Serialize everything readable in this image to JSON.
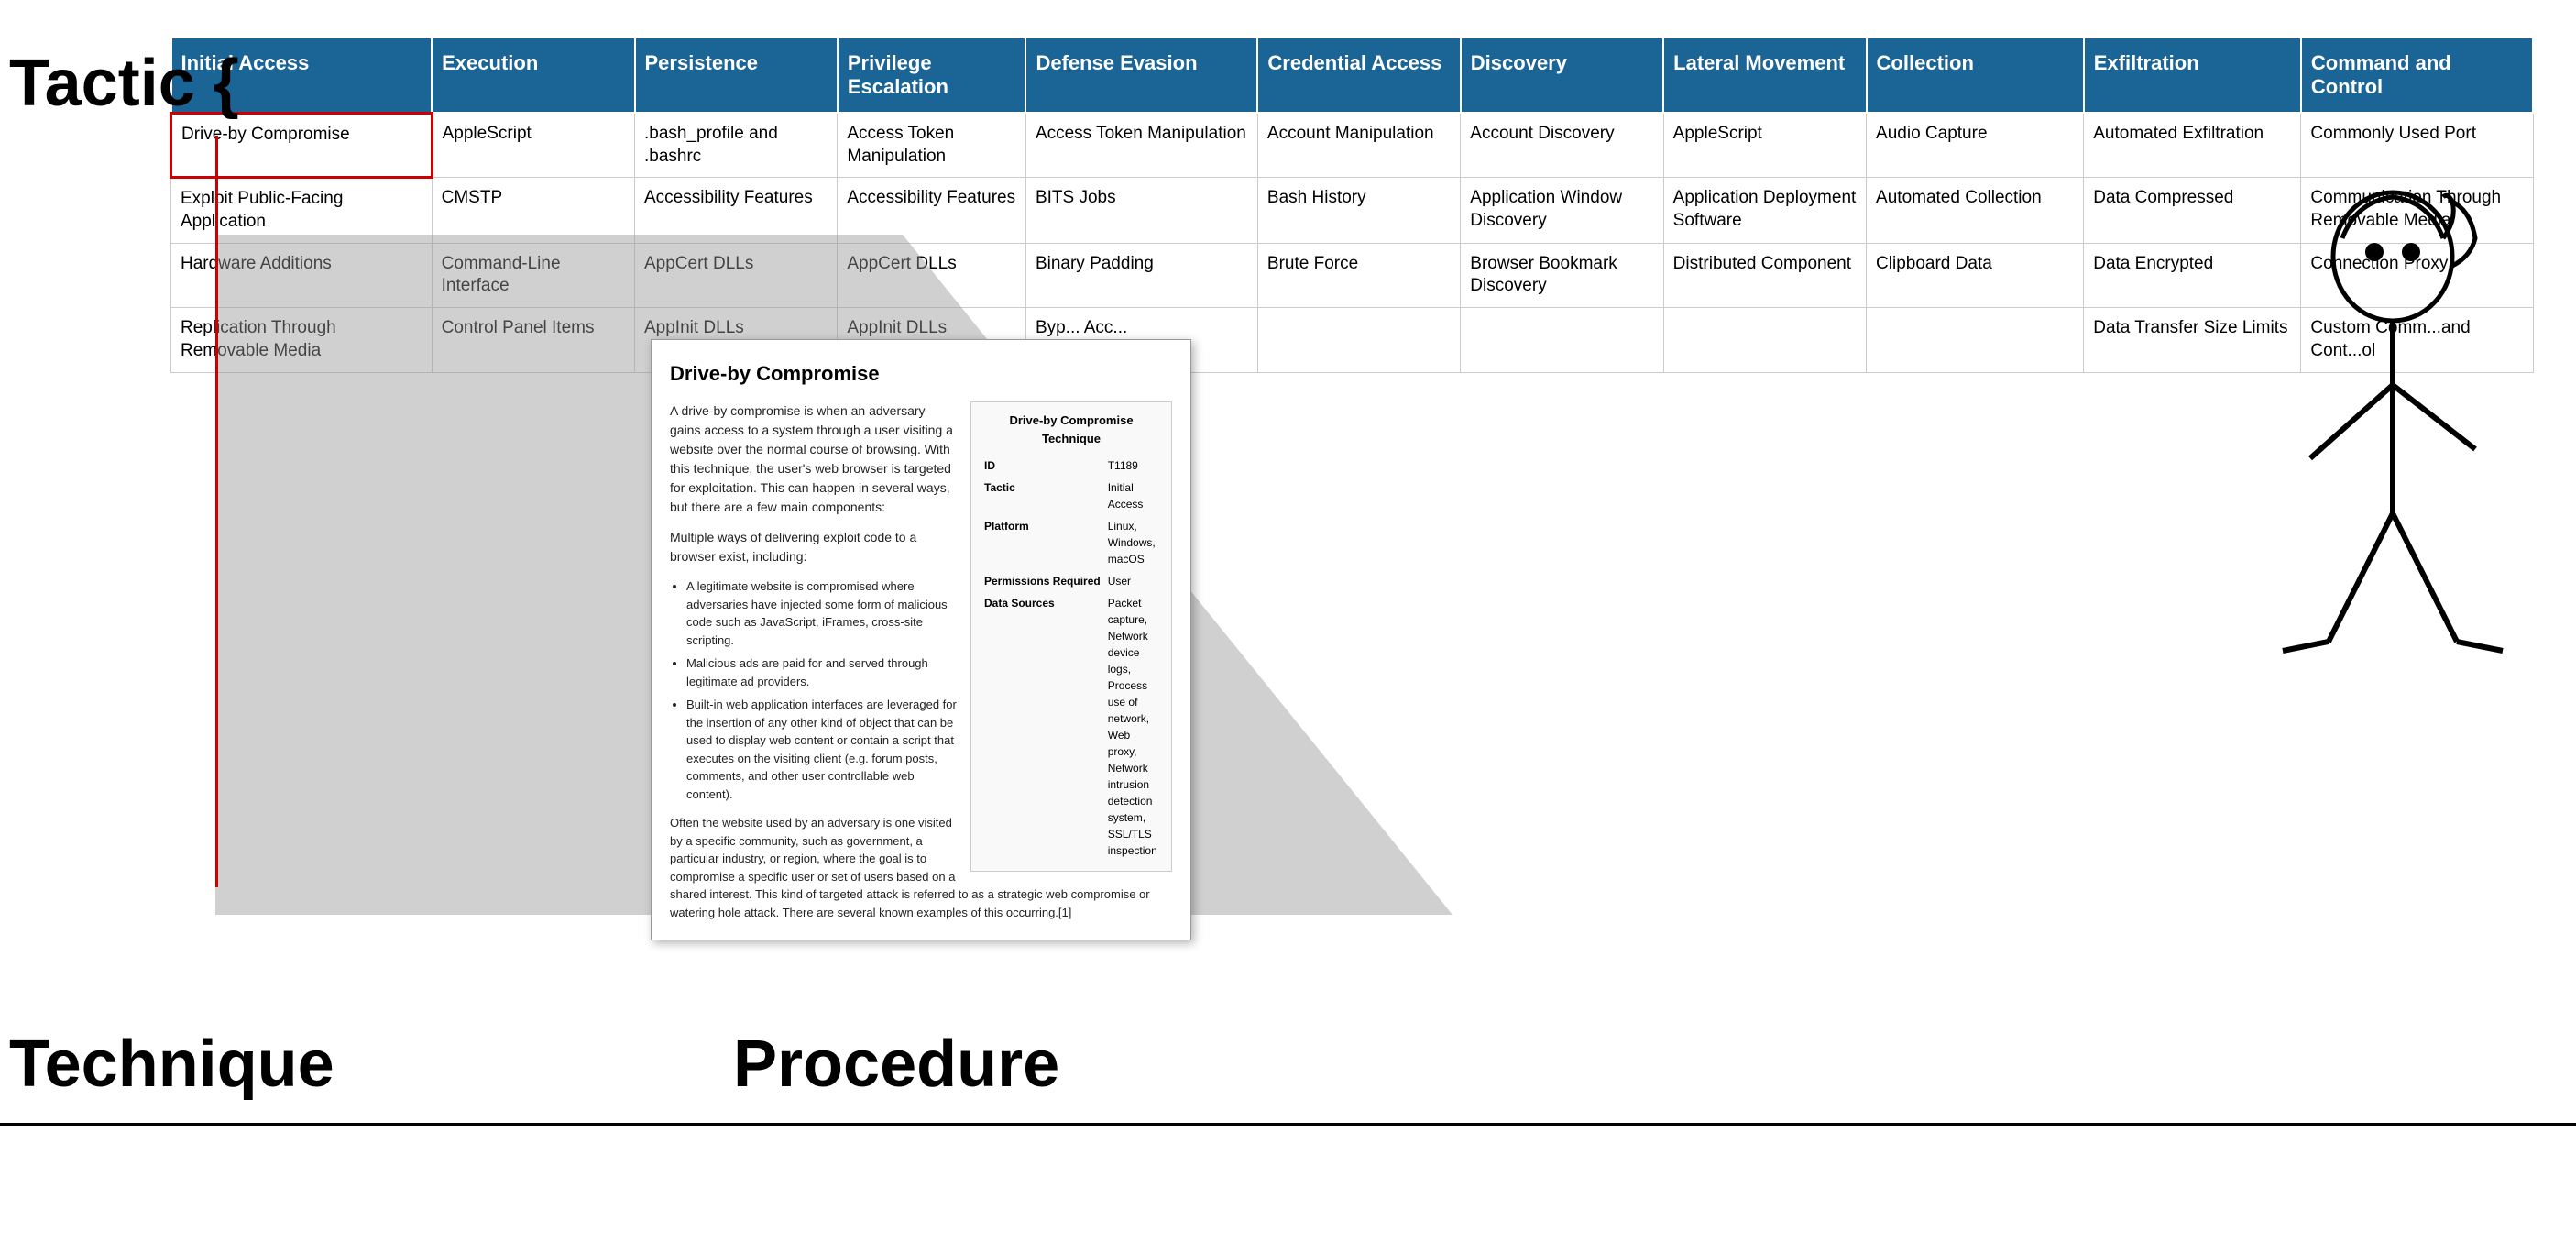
{
  "labels": {
    "tactic": "Tactic {",
    "technique": "Technique",
    "procedure": "Procedure"
  },
  "table": {
    "headers": [
      "Initial Access",
      "Execution",
      "Persistence",
      "Privilege Escalation",
      "Defense Evasion",
      "Credential Access",
      "Discovery",
      "Lateral Movement",
      "Collection",
      "Exfiltration",
      "Command and Control"
    ],
    "rows": [
      [
        "Drive-by Compromise",
        "AppleScript",
        ".bash_profile and .bashrc",
        "Access Token Manipulation",
        "Access Token Manipulation",
        "Account Manipulation",
        "Account Discovery",
        "AppleScript",
        "Audio Capture",
        "Automated Exfiltration",
        "Commonly Used Port"
      ],
      [
        "Exploit Public-Facing Application",
        "CMSTP",
        "Accessibility Features",
        "Accessibility Features",
        "BITS Jobs",
        "Bash History",
        "Application Window Discovery",
        "Application Deployment Software",
        "Automated Collection",
        "Data Compressed",
        "Communication Through Removable Media"
      ],
      [
        "Hardware Additions",
        "Command-Line Interface",
        "AppCert DLLs",
        "AppCert DLLs",
        "Binary Padding",
        "Brute Force",
        "Browser Bookmark Discovery",
        "Distributed Component",
        "Clipboard Data",
        "Data Encrypted",
        "Connection Proxy"
      ],
      [
        "Replication Through Removable Media",
        "Control Panel Items",
        "AppInit DLLs",
        "AppInit DLLs",
        "Byp... Acc...",
        "",
        "",
        "",
        "",
        "Data Transfer Size Limits",
        "Custom Comm...and Cont...ol"
      ]
    ]
  },
  "tooltip": {
    "title": "Drive-by Compromise",
    "description1": "A drive-by compromise is when an adversary gains access to a system through a user visiting a website over the normal course of browsing. With this technique, the user's web browser is targeted for exploitation. This can happen in several ways, but there are a few main components:",
    "description2": "Multiple ways of delivering exploit code to a browser exist, including:",
    "bullets": [
      "A legitimate website is compromised where adversaries have injected some form of malicious code such as JavaScript, iFrames, cross-site scripting.",
      "Malicious ads are paid for and served through legitimate ad providers.",
      "Built-in web application interfaces are leveraged for the insertion of any other kind of object that can be used to display web content or contain a script that executes on the visiting client (e.g. forum posts, comments, and other user controllable web content)."
    ],
    "footer": "Often the website used by an adversary is one visited by a specific community, such as government, a particular industry, or region, where the goal is to compromise a specific user or set of users based on a shared interest. This kind of targeted attack is referred to as a strategic web compromise or watering hole attack. There are several known examples of this occurring.[1]",
    "info": {
      "title": "Drive-by Compromise Technique",
      "id": "T1189",
      "tactic": "Initial Access",
      "platform": "Linux, Windows, macOS",
      "permissions": "User",
      "data_sources": "Packet capture, Network device logs, Process use of network, Web proxy, Network intrusion detection system, SSL/TLS inspection"
    }
  }
}
